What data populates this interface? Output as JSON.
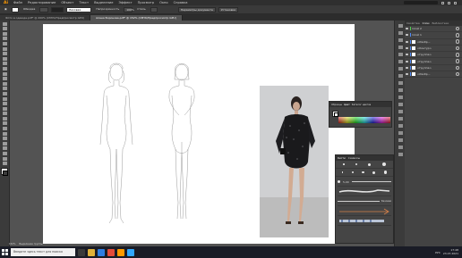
{
  "app": {
    "logo": "Ai"
  },
  "menu": {
    "items": [
      "Файл",
      "Редактирование",
      "Объект",
      "Текст",
      "Выделение",
      "Эффект",
      "Просмотр",
      "Окно",
      "Справка"
    ]
  },
  "controlbar": {
    "stroke_label": "Обводка",
    "opacity_label": "Непрозрачность",
    "style_label": "Стиль",
    "doc_settings": "Параметры документа",
    "prefs": "Установки",
    "basic_brush": "Базовая",
    "percent": "100%"
  },
  "tabs": [
    {
      "label": "Фото в одежде.pdf* @ 200% (CMYK/Предпросмотр GPU)",
      "active": false
    },
    {
      "label": "Алена Боронова.pdf* @ 152% (CMYK/Предпросмотр GPU)",
      "active": true
    }
  ],
  "layers": {
    "tabs": [
      "Свойства",
      "Слои",
      "Библиотеки"
    ],
    "rows": [
      {
        "label": "Слой 2",
        "color": "#4fd04f"
      },
      {
        "label": "Слой 1",
        "color": "#4f8cff"
      },
      {
        "label": "<Изобр...",
        "color": "#4f8cff"
      },
      {
        "label": "<Контур>",
        "color": "#4f8cff"
      },
      {
        "label": "<Группа>",
        "color": "#4f8cff"
      },
      {
        "label": "<Группа>",
        "color": "#4f8cff"
      },
      {
        "label": "<Группа>",
        "color": "#4f8cff"
      },
      {
        "label": "<Изобр...",
        "color": "#4f8cff"
      }
    ]
  },
  "color_panel": {
    "tabs": [
      "Образцы",
      "Цвет",
      "Каталог цветов"
    ],
    "fill": "#ffffff",
    "stroke": "#000000"
  },
  "brushes_panel": {
    "tabs": [
      "Кисти",
      "Символы"
    ],
    "size_label": "5,00",
    "basic_label": "Базовая"
  },
  "statusbar": {
    "zoom": "152%",
    "tool": "Выделение группы"
  },
  "taskbar": {
    "search_placeholder": "Введите здесь текст для поиска",
    "time": "17:48",
    "date": "23.07.2021",
    "lang": "РУС"
  }
}
